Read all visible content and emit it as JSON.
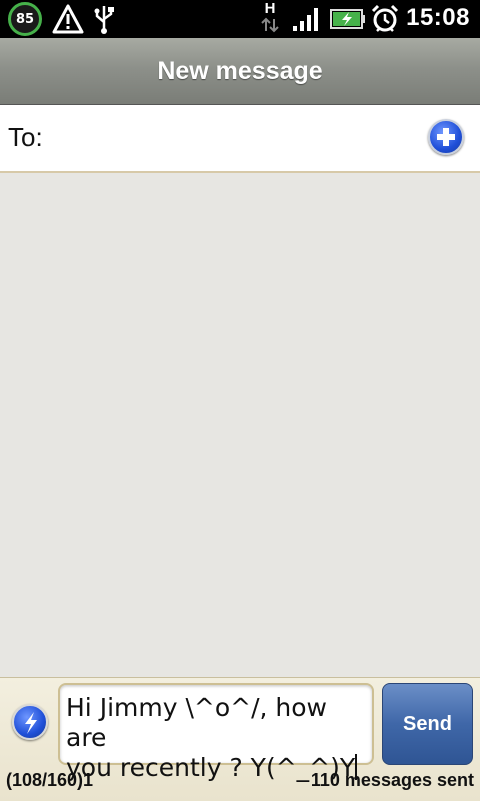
{
  "status_bar": {
    "battery_level": "85",
    "time": "15:08",
    "network_type": "H",
    "icons": [
      "battery-level-icon",
      "warning-icon",
      "usb-icon",
      "network-type-icon",
      "signal-icon",
      "battery-charging-icon",
      "alarm-icon"
    ],
    "accent_color": "#46b14a"
  },
  "header": {
    "title": "New message"
  },
  "recipient": {
    "label": "To:",
    "value": "",
    "add_icon": "plus-icon"
  },
  "composer": {
    "message_line1": "Hi Jimmy \\^o^/, how are",
    "message_line2": "you recently ?  Y(^_^)Y",
    "send_label": "Send",
    "char_counter": "(108/160)1",
    "messages_sent": "110 messages sent",
    "quick_icon": "lightning-icon",
    "send_color": "#3f67a8"
  }
}
